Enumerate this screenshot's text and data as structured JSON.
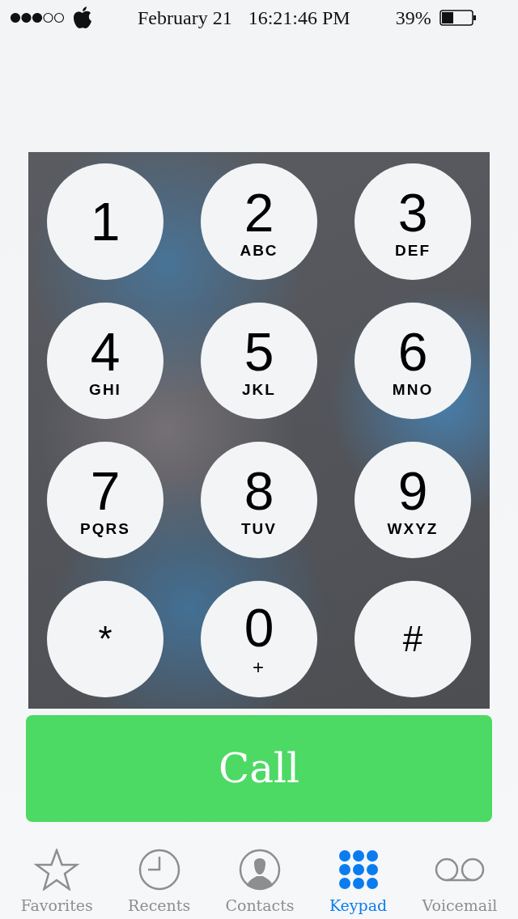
{
  "status_bar": {
    "date": "February 21",
    "time": "16:21:46 PM",
    "battery": "39%"
  },
  "keypad": [
    {
      "digit": "1"
    },
    {
      "digit": "2",
      "letters": "ABC"
    },
    {
      "digit": "3",
      "letters": "DEF"
    },
    {
      "digit": "4",
      "letters": "GHI"
    },
    {
      "digit": "5",
      "letters": "JKL"
    },
    {
      "digit": "6",
      "letters": "MNO"
    },
    {
      "digit": "7",
      "letters": "PQRS"
    },
    {
      "digit": "8",
      "letters": "TUV"
    },
    {
      "digit": "9",
      "letters": "WXYZ"
    },
    {
      "digit": "*",
      "kind": "symbol"
    },
    {
      "digit": "0",
      "letters": "+"
    },
    {
      "digit": "#",
      "kind": "symbol"
    }
  ],
  "call_button": {
    "label": "Call"
  },
  "tabs": [
    {
      "label": "Favorites",
      "kind": "star",
      "selected": false
    },
    {
      "label": "Recents",
      "kind": "clock",
      "selected": false
    },
    {
      "label": "Contacts",
      "kind": "person",
      "selected": false
    },
    {
      "label": "Keypad",
      "kind": "dots",
      "selected": true
    },
    {
      "label": "Voicemail",
      "kind": "voicemail",
      "selected": false
    }
  ]
}
